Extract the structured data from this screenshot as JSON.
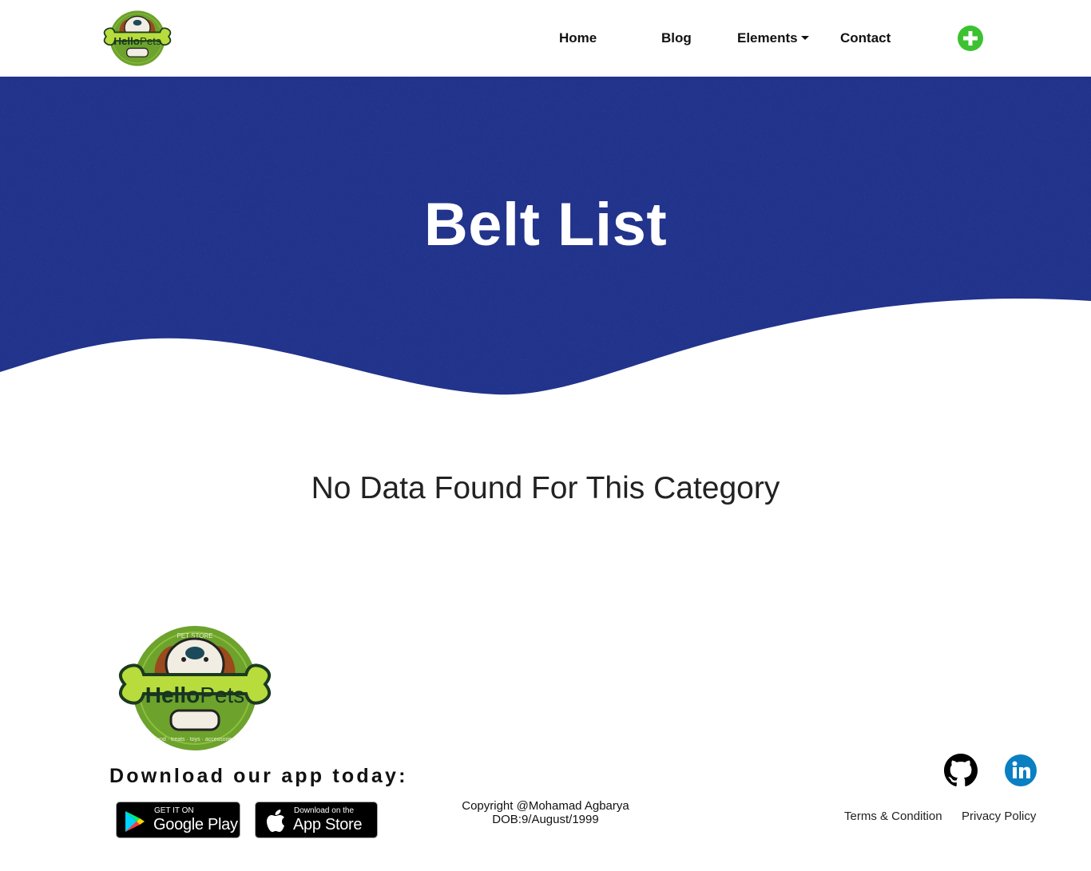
{
  "brand": {
    "logo_text_hello": "Hello",
    "logo_text_pets": "Pets",
    "logo_top_text": "PET STORE",
    "logo_bottom_text": "food · treats · toys · accessories"
  },
  "nav": {
    "home": "Home",
    "blog": "Blog",
    "elements": "Elements",
    "contact": "Contact"
  },
  "banner": {
    "title": "Belt List",
    "color": "#22338c"
  },
  "main": {
    "empty_message": "No Data Found For This Category"
  },
  "footer": {
    "download_title": "Download our app today:",
    "google_play": {
      "small": "GET IT ON",
      "big": "Google Play"
    },
    "app_store": {
      "small": "Download on the",
      "big": "App Store"
    },
    "copyright_line1": "Copyright @Mohamad Agbarya",
    "copyright_line2": "DOB:9/August/1999",
    "terms": "Terms & Condition",
    "privacy": "Privacy Policy"
  },
  "icons": {
    "add": "plus-circle-icon",
    "github": "github-icon",
    "linkedin": "linkedin-icon"
  },
  "colors": {
    "add_button": "#3cc230",
    "logo_green": "#6da22d",
    "logo_bone": "#b7dc3c",
    "linkedin": "#0a7fc1"
  }
}
